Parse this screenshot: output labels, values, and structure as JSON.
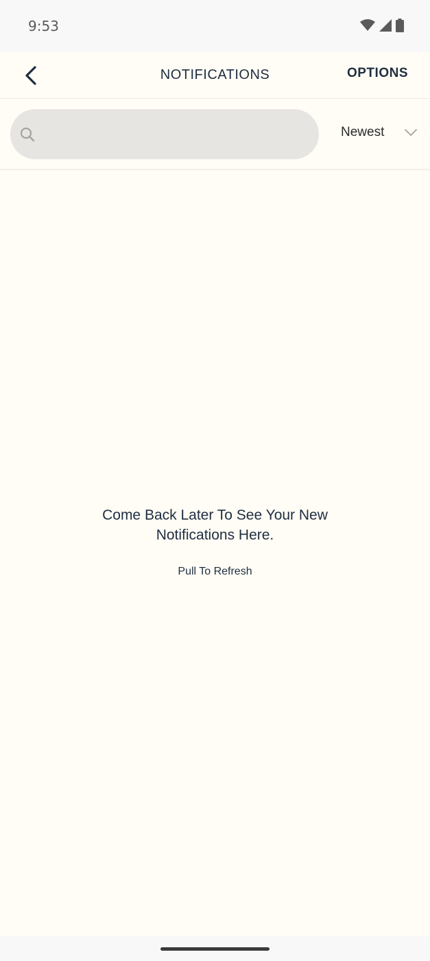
{
  "status_bar": {
    "time": "9:53",
    "icons": [
      "wifi-icon",
      "cellular-signal-icon",
      "battery-icon"
    ]
  },
  "header": {
    "back_icon": "chevron-left-icon",
    "title": "NOTIFICATIONS",
    "options_label": "OPTIONS"
  },
  "search": {
    "value": "",
    "placeholder": "",
    "icon": "search-icon"
  },
  "sort": {
    "selected": "Newest",
    "icon": "chevron-down-icon"
  },
  "empty_state": {
    "message": "Come Back Later To See Your New Notifications Here.",
    "hint": "Pull To Refresh"
  },
  "colors": {
    "background": "#fffdf5",
    "text_primary": "#1f2d40",
    "search_bg": "#e6e5e2"
  }
}
